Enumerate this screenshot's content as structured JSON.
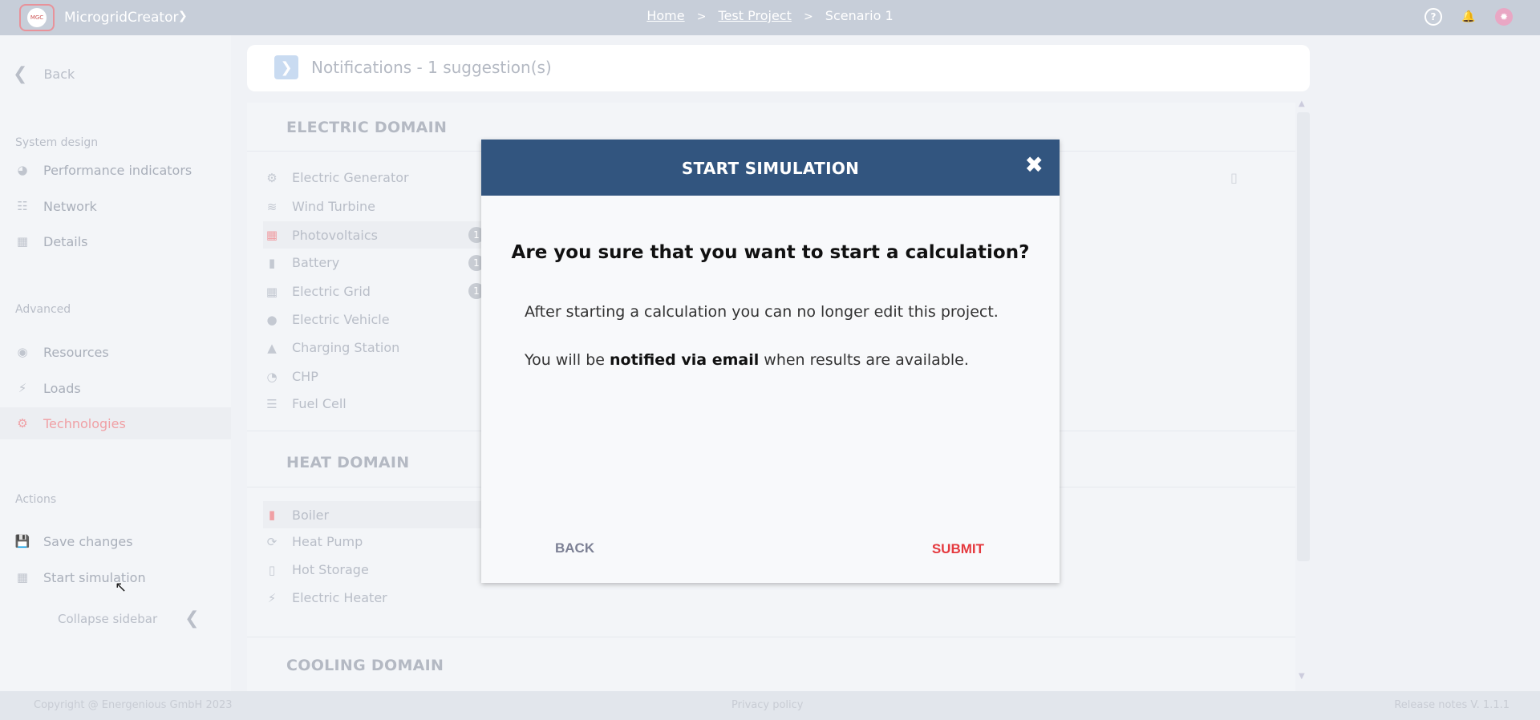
{
  "topbar": {
    "logo_text": "MGC",
    "app_name": "MicrogridCreator",
    "breadcrumb": {
      "home": "Home",
      "sep1": ">",
      "project": "Test Project",
      "sep2": ">",
      "scenario": "Scenario 1"
    },
    "icons": [
      "help-icon",
      "bell-icon",
      "avatar-icon"
    ]
  },
  "sidebar": {
    "back_label": "Back",
    "system_design_title": "System design",
    "system_design_items": [
      {
        "label": "Performance indicators",
        "icon": "pie-chart-icon"
      },
      {
        "label": "Network",
        "icon": "network-icon"
      },
      {
        "label": "Details",
        "icon": "table-icon"
      }
    ],
    "advanced_title": "Advanced",
    "advanced_items": [
      {
        "label": "Resources",
        "icon": "globe-icon"
      },
      {
        "label": "Loads",
        "icon": "bolt-icon"
      },
      {
        "label": "Technologies",
        "icon": "gears-icon",
        "active": true
      }
    ],
    "actions_title": "Actions",
    "actions_items": [
      {
        "label": "Save changes",
        "icon": "save-icon"
      },
      {
        "label": "Start simulation",
        "icon": "calculator-icon"
      }
    ],
    "collapse_label": "Collapse sidebar"
  },
  "notifications": {
    "text": "Notifications - 1 suggestion(s)"
  },
  "domains": {
    "electric": {
      "title": "ELECTRIC DOMAIN",
      "items": [
        {
          "label": "Electric Generator"
        },
        {
          "label": "Wind Turbine"
        },
        {
          "label": "Photovoltaics",
          "badge": "1"
        },
        {
          "label": "Battery",
          "badge": "1"
        },
        {
          "label": "Electric Grid",
          "badge": "1"
        },
        {
          "label": "Electric Vehicle"
        },
        {
          "label": "Charging Station"
        },
        {
          "label": "CHP"
        },
        {
          "label": "Fuel Cell"
        }
      ]
    },
    "heat": {
      "title": "HEAT DOMAIN",
      "items": [
        {
          "label": "Boiler"
        },
        {
          "label": "Heat Pump"
        },
        {
          "label": "Hot Storage"
        },
        {
          "label": "Electric Heater"
        }
      ]
    },
    "cooling": {
      "title": "COOLING DOMAIN"
    }
  },
  "footer": {
    "copyright": "Copyright @ Energenious GmbH 2023",
    "privacy": "Privacy policy",
    "release": "Release notes V. 1.1.1"
  },
  "modal": {
    "title": "START SIMULATION",
    "question": "Are you sure that you want to start a calculation?",
    "paragraph1": "After starting a calculation you can no longer edit this project.",
    "paragraph2_pre": "You will be ",
    "paragraph2_bold": "notified via email",
    "paragraph2_post": " when results are available.",
    "back_label": "BACK",
    "submit_label": "SUBMIT"
  },
  "colors": {
    "modal_header": "#32557f",
    "submit": "#e53a3f",
    "accent_pink": "#f0a0a5"
  }
}
